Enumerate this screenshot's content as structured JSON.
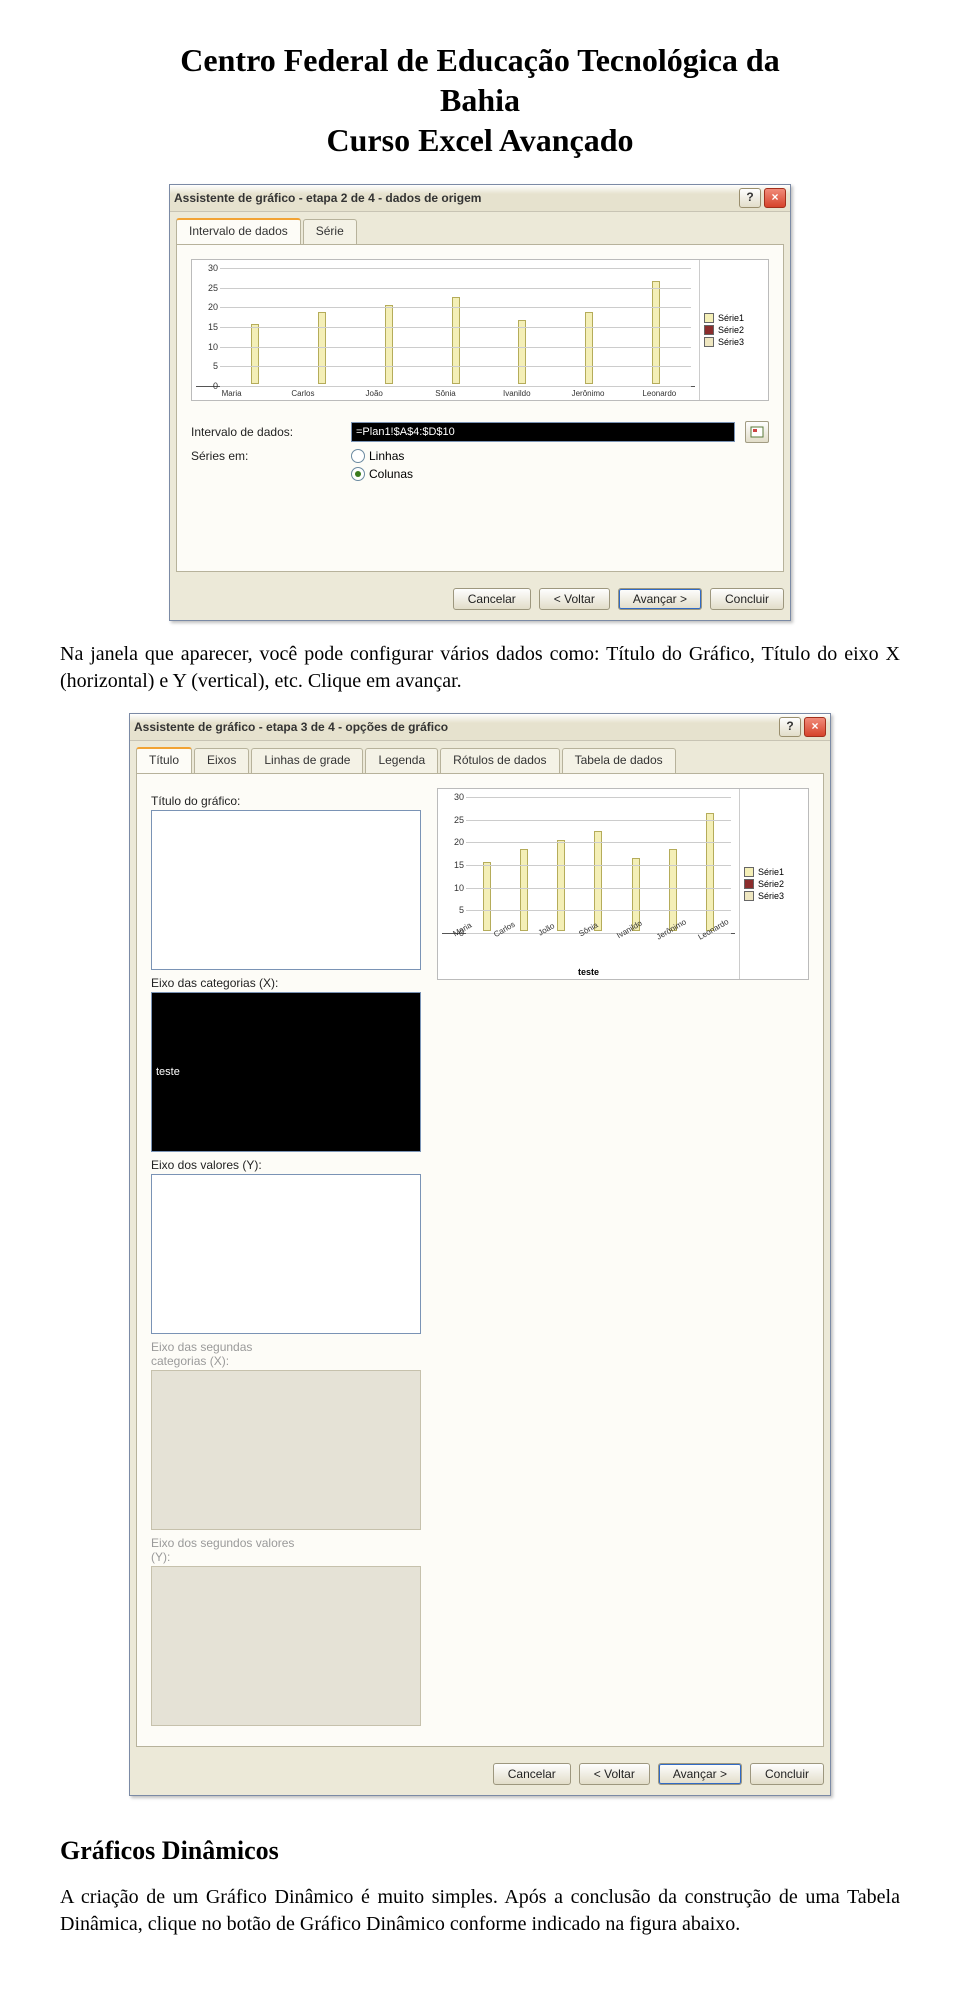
{
  "header": {
    "line1": "Centro Federal de Educação Tecnológica da",
    "line2": "Bahia",
    "line3": "Curso Excel Avançado"
  },
  "paragraph1": "Na janela que aparecer, você pode configurar vários dados como: Título do Gráfico, Título do eixo X (horizontal) e Y (vertical), etc. Clique em avançar.",
  "sectionHeading": "Gráficos Dinâmicos",
  "paragraph2": "A criação de um Gráfico Dinâmico é muito simples. Após a conclusão da construção de uma Tabela Dinâmica, clique no botão de Gráfico Dinâmico conforme indicado na figura abaixo.",
  "dialog1": {
    "title": "Assistente de gráfico - etapa 2 de 4 - dados de origem",
    "help": "?",
    "close": "×",
    "tabs": {
      "active": "Intervalo de dados",
      "other": "Série"
    },
    "form": {
      "rangeLabel": "Intervalo de dados:",
      "rangeValue": "=Plan1!$A$4:$D$10",
      "seriesLabel": "Séries em:",
      "radioLines": "Linhas",
      "radioCols": "Colunas"
    },
    "buttons": {
      "cancel": "Cancelar",
      "back": "< Voltar",
      "next": "Avançar >",
      "finish": "Concluir"
    }
  },
  "dialog2": {
    "title": "Assistente de gráfico - etapa 3 de 4 - opções de gráfico",
    "help": "?",
    "close": "×",
    "tabs": [
      "Título",
      "Eixos",
      "Linhas de grade",
      "Legenda",
      "Rótulos de dados",
      "Tabela de dados"
    ],
    "form": {
      "titleLabel": "Título do gráfico:",
      "titleValue": "",
      "catXLabel": "Eixo das categorias (X):",
      "catXValue": "teste",
      "valYLabel": "Eixo dos valores (Y):",
      "valYValue": "",
      "secCatLabel": "Eixo das segundas categorias (X):",
      "secValLabel": "Eixo dos segundos valores (Y):"
    },
    "xlabel": "teste",
    "buttons": {
      "cancel": "Cancelar",
      "back": "< Voltar",
      "next": "Avançar >",
      "finish": "Concluir"
    }
  },
  "legend": {
    "s1": "Série1",
    "s2": "Série2",
    "s3": "Série3"
  },
  "chart_data": {
    "type": "bar",
    "categories": [
      "Maria",
      "Carlos",
      "João",
      "Sônia",
      "Ivanildo",
      "Jerônimo",
      "Leonardo"
    ],
    "series": [
      {
        "name": "Série1",
        "values": [
          15,
          18,
          20,
          22,
          16,
          18,
          26
        ]
      },
      {
        "name": "Série2",
        "values": [
          0,
          0,
          0,
          0,
          0,
          0,
          0
        ]
      },
      {
        "name": "Série3",
        "values": [
          0,
          0,
          0,
          0,
          0,
          0,
          0
        ]
      }
    ],
    "ylim": [
      0,
      30
    ],
    "yticks": [
      0,
      5,
      10,
      15,
      20,
      25,
      30
    ]
  }
}
